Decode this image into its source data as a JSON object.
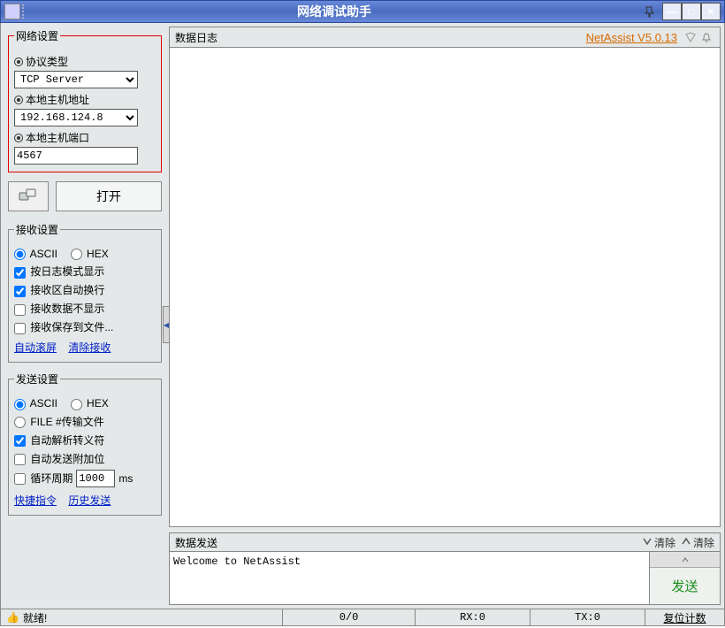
{
  "title": "网络调试助手",
  "version": "NetAssist V5.0.13",
  "network_settings": {
    "legend": "网络设置",
    "protocol_label": "协议类型",
    "protocol_value": "TCP Server",
    "host_label": "本地主机地址",
    "host_value": "192.168.124.8",
    "port_label": "本地主机端口",
    "port_value": "4567",
    "open_label": "打开"
  },
  "recv_settings": {
    "legend": "接收设置",
    "ascii": "ASCII",
    "hex": "HEX",
    "log_mode": "按日志模式显示",
    "auto_wrap": "接收区自动换行",
    "no_display": "接收数据不显示",
    "save_file": "接收保存到文件...",
    "auto_scroll": "自动滚屏",
    "clear_recv": "清除接收"
  },
  "send_settings": {
    "legend": "发送设置",
    "ascii": "ASCII",
    "hex": "HEX",
    "file_transfer": "FILE #传输文件",
    "auto_escape": "自动解析转义符",
    "auto_append": "自动发送附加位",
    "cycle_label": "循环周期",
    "cycle_value": "1000",
    "cycle_unit": "ms",
    "quick_cmd": "快捷指令",
    "history": "历史发送"
  },
  "log_panel": {
    "title": "数据日志"
  },
  "send_panel": {
    "title": "数据发送",
    "clear1": "清除",
    "clear2": "清除",
    "text": "Welcome to NetAssist",
    "send_btn": "发送"
  },
  "statusbar": {
    "ready": "就绪!",
    "counter": "0/0",
    "rx": "RX:0",
    "tx": "TX:0",
    "reset": "复位计数"
  }
}
